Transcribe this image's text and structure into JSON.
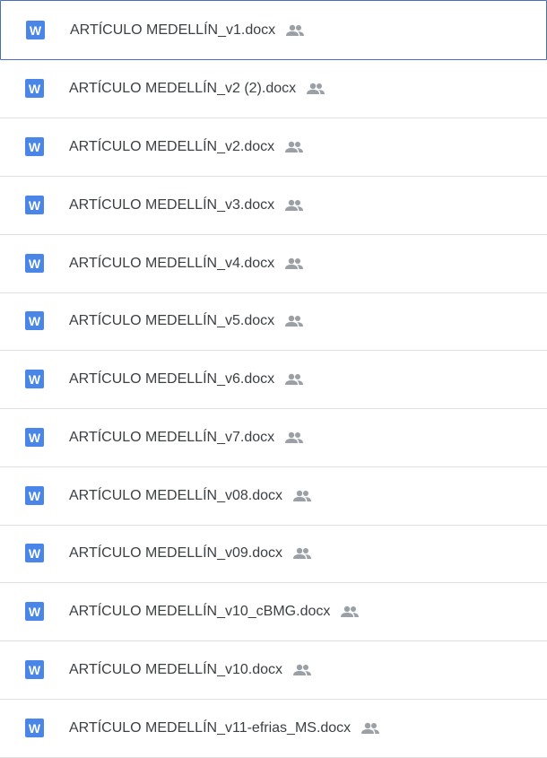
{
  "files": [
    {
      "name": "ARTÍCULO MEDELLÍN_v1.docx",
      "type_icon": "word-doc-icon",
      "type_letter": "W",
      "shared": true,
      "selected": true
    },
    {
      "name": "ARTÍCULO MEDELLÍN_v2 (2).docx",
      "type_icon": "word-doc-icon",
      "type_letter": "W",
      "shared": true,
      "selected": false
    },
    {
      "name": "ARTÍCULO MEDELLÍN_v2.docx",
      "type_icon": "word-doc-icon",
      "type_letter": "W",
      "shared": true,
      "selected": false
    },
    {
      "name": "ARTÍCULO MEDELLÍN_v3.docx",
      "type_icon": "word-doc-icon",
      "type_letter": "W",
      "shared": true,
      "selected": false
    },
    {
      "name": "ARTÍCULO MEDELLÍN_v4.docx",
      "type_icon": "word-doc-icon",
      "type_letter": "W",
      "shared": true,
      "selected": false
    },
    {
      "name": "ARTÍCULO MEDELLÍN_v5.docx",
      "type_icon": "word-doc-icon",
      "type_letter": "W",
      "shared": true,
      "selected": false
    },
    {
      "name": "ARTÍCULO MEDELLÍN_v6.docx",
      "type_icon": "word-doc-icon",
      "type_letter": "W",
      "shared": true,
      "selected": false
    },
    {
      "name": "ARTÍCULO MEDELLÍN_v7.docx",
      "type_icon": "word-doc-icon",
      "type_letter": "W",
      "shared": true,
      "selected": false
    },
    {
      "name": "ARTÍCULO MEDELLÍN_v08.docx",
      "type_icon": "word-doc-icon",
      "type_letter": "W",
      "shared": true,
      "selected": false
    },
    {
      "name": "ARTÍCULO MEDELLÍN_v09.docx",
      "type_icon": "word-doc-icon",
      "type_letter": "W",
      "shared": true,
      "selected": false
    },
    {
      "name": "ARTÍCULO MEDELLÍN_v10_cBMG.docx",
      "type_icon": "word-doc-icon",
      "type_letter": "W",
      "shared": true,
      "selected": false
    },
    {
      "name": "ARTÍCULO MEDELLÍN_v10.docx",
      "type_icon": "word-doc-icon",
      "type_letter": "W",
      "shared": true,
      "selected": false
    },
    {
      "name": "ARTÍCULO MEDELLÍN_v11-efrias_MS.docx",
      "type_icon": "word-doc-icon",
      "type_letter": "W",
      "shared": true,
      "selected": false
    }
  ],
  "colors": {
    "word_icon_bg": "#4a86e8",
    "selected_border": "#4a6ebd",
    "divider": "#e0e0e0",
    "text": "#3c4043",
    "shared_icon": "#9aa0a6"
  },
  "shared_icon_name": "people-shared-icon"
}
